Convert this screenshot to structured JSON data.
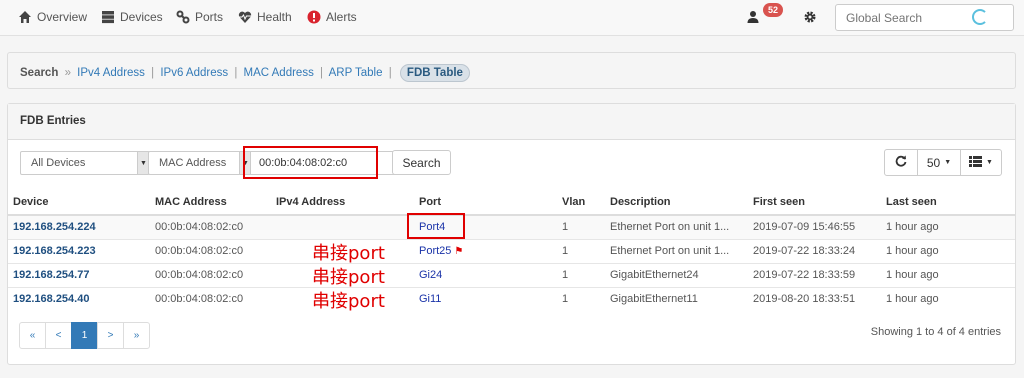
{
  "nav": {
    "items": [
      {
        "label": "Overview",
        "icon": "home-icon"
      },
      {
        "label": "Devices",
        "icon": "server-icon"
      },
      {
        "label": "Ports",
        "icon": "link-icon"
      },
      {
        "label": "Health",
        "icon": "heartbeat-icon"
      },
      {
        "label": "Alerts",
        "icon": "alert-icon"
      }
    ],
    "user_badge": "52",
    "search_placeholder": "Global Search"
  },
  "breadcrumb": {
    "root": "Search",
    "links": [
      "IPv4 Address",
      "IPv6 Address",
      "MAC Address",
      "ARP Table"
    ],
    "active": "FDB Table"
  },
  "fdb": {
    "title": "FDB Entries",
    "device_filter": "All Devices",
    "field_filter": "MAC Address",
    "query": "00:0b:04:08:02:c0",
    "search_label": "Search",
    "page_size": "50",
    "columns": [
      "Device",
      "MAC Address",
      "IPv4 Address",
      "Port",
      "Vlan",
      "Description",
      "First seen",
      "Last seen"
    ],
    "rows": [
      {
        "device": "192.168.254.224",
        "mac": "00:0b:04:08:02:c0",
        "ipv4": "",
        "port": "Port4",
        "vlan": "1",
        "desc": "Ethernet Port on unit 1...",
        "first": "2019-07-09 15:46:55",
        "last": "1 hour ago"
      },
      {
        "device": "192.168.254.223",
        "mac": "00:0b:04:08:02:c0",
        "ipv4": "",
        "port": "Port25",
        "vlan": "1",
        "desc": "Ethernet Port on unit 1...",
        "first": "2019-07-22 18:33:24",
        "last": "1 hour ago"
      },
      {
        "device": "192.168.254.77",
        "mac": "00:0b:04:08:02:c0",
        "ipv4": "",
        "port": "Gi24",
        "vlan": "1",
        "desc": "GigabitEthernet24",
        "first": "2019-07-22 18:33:59",
        "last": "1 hour ago"
      },
      {
        "device": "192.168.254.40",
        "mac": "00:0b:04:08:02:c0",
        "ipv4": "",
        "port": "Gi11",
        "vlan": "1",
        "desc": "GigabitEthernet11",
        "first": "2019-08-20 18:33:51",
        "last": "1 hour ago"
      }
    ],
    "annotation": "串接port",
    "pager": [
      "«",
      "<",
      "1",
      ">",
      "»"
    ],
    "showing": "Showing 1 to 4 of 4 entries"
  },
  "colors": {
    "annotation_red": "#e00000",
    "link_blue": "#337ab7",
    "badge_red": "#d9534f"
  }
}
